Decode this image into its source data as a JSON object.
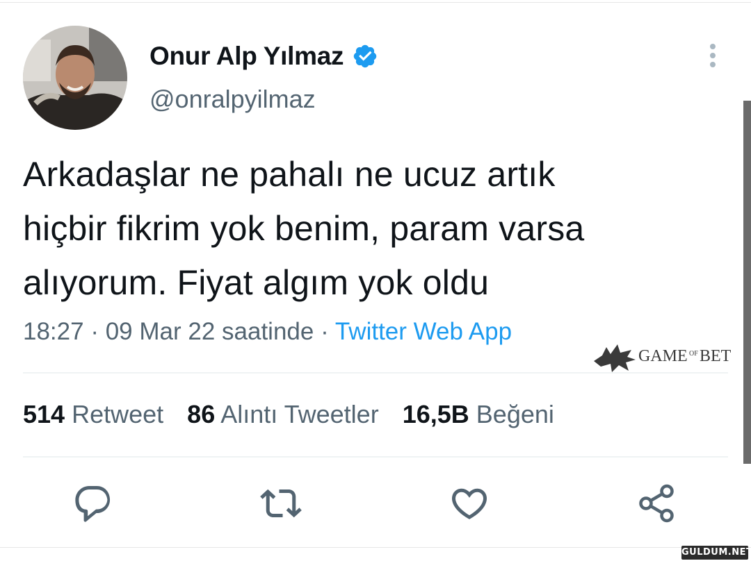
{
  "author": {
    "display_name": "Onur Alp Yılmaz",
    "handle": "@onralpyilmaz",
    "verified": true
  },
  "tweet": {
    "lines": [
      "Arkadaşlar ne pahalı ne ucuz artık",
      "hiçbir fikrim yok benim, param varsa",
      "alıyorum. Fiyat algım yok oldu"
    ],
    "time": "18:27",
    "date_text": "09 Mar 22 saatinde",
    "separator": "·",
    "source": "Twitter Web App"
  },
  "stats": {
    "retweets_count": "514",
    "retweets_label": "Retweet",
    "quotes_count": "86",
    "quotes_label": "Alıntı Tweetler",
    "likes_count": "16,5B",
    "likes_label": "Beğeni"
  },
  "actions": [
    "reply-icon",
    "retweet-icon",
    "like-icon",
    "share-icon"
  ],
  "watermarks": {
    "gameofbet_text": "GAMEofBET",
    "corner_text": "GULDUM.NET"
  },
  "colors": {
    "text": "#0f1419",
    "secondary": "#536471",
    "accent": "#1d9bf0",
    "divider": "#eff3f4"
  }
}
